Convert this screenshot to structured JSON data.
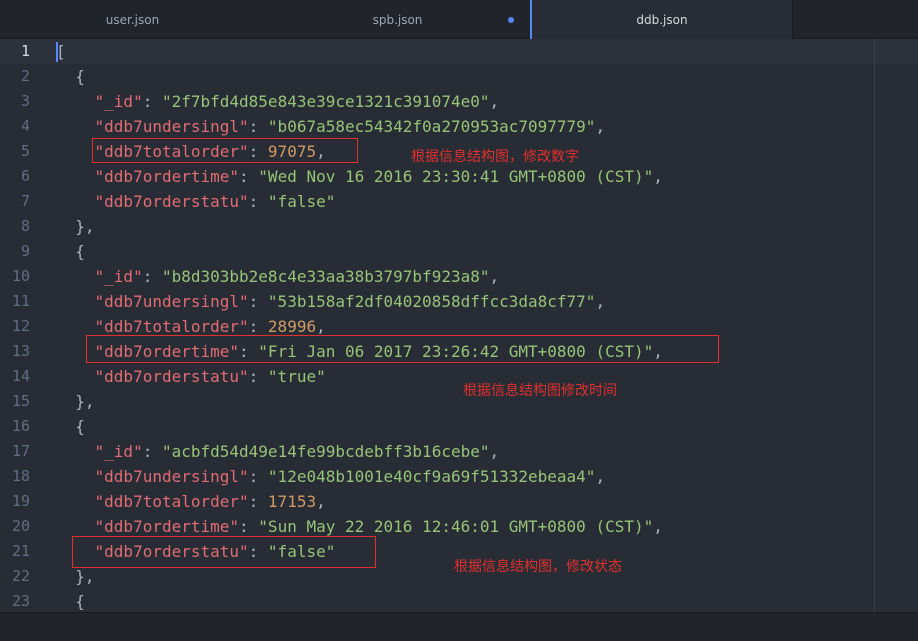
{
  "tabs": [
    {
      "label": "user.json",
      "modified": false,
      "active": false
    },
    {
      "label": "spb.json",
      "modified": true,
      "active": false
    },
    {
      "label": "ddb.json",
      "modified": false,
      "active": true
    }
  ],
  "line_numbers": [
    "1",
    "2",
    "3",
    "4",
    "5",
    "6",
    "7",
    "8",
    "9",
    "10",
    "11",
    "12",
    "13",
    "14",
    "15",
    "16",
    "17",
    "18",
    "19",
    "20",
    "21",
    "22",
    "23"
  ],
  "lines": [
    [
      {
        "t": "p",
        "v": "["
      }
    ],
    [
      {
        "t": "p",
        "v": "  {"
      }
    ],
    [
      {
        "t": "p",
        "v": "    "
      },
      {
        "t": "k",
        "v": "\"_id\""
      },
      {
        "t": "p",
        "v": ": "
      },
      {
        "t": "s",
        "v": "\"2f7bfd4d85e843e39ce1321c391074e0\""
      },
      {
        "t": "p",
        "v": ","
      }
    ],
    [
      {
        "t": "p",
        "v": "    "
      },
      {
        "t": "k",
        "v": "\"ddb7undersingl\""
      },
      {
        "t": "p",
        "v": ": "
      },
      {
        "t": "s",
        "v": "\"b067a58ec54342f0a270953ac7097779\""
      },
      {
        "t": "p",
        "v": ","
      }
    ],
    [
      {
        "t": "p",
        "v": "    "
      },
      {
        "t": "k",
        "v": "\"ddb7totalorder\""
      },
      {
        "t": "p",
        "v": ": "
      },
      {
        "t": "n",
        "v": "97075"
      },
      {
        "t": "p",
        "v": ","
      }
    ],
    [
      {
        "t": "p",
        "v": "    "
      },
      {
        "t": "k",
        "v": "\"ddb7ordertime\""
      },
      {
        "t": "p",
        "v": ": "
      },
      {
        "t": "s",
        "v": "\"Wed Nov 16 2016 23:30:41 GMT+0800 (CST)\""
      },
      {
        "t": "p",
        "v": ","
      }
    ],
    [
      {
        "t": "p",
        "v": "    "
      },
      {
        "t": "k",
        "v": "\"ddb7orderstatu\""
      },
      {
        "t": "p",
        "v": ": "
      },
      {
        "t": "s",
        "v": "\"false\""
      }
    ],
    [
      {
        "t": "p",
        "v": "  },"
      }
    ],
    [
      {
        "t": "p",
        "v": "  {"
      }
    ],
    [
      {
        "t": "p",
        "v": "    "
      },
      {
        "t": "k",
        "v": "\"_id\""
      },
      {
        "t": "p",
        "v": ": "
      },
      {
        "t": "s",
        "v": "\"b8d303bb2e8c4e33aa38b3797bf923a8\""
      },
      {
        "t": "p",
        "v": ","
      }
    ],
    [
      {
        "t": "p",
        "v": "    "
      },
      {
        "t": "k",
        "v": "\"ddb7undersingl\""
      },
      {
        "t": "p",
        "v": ": "
      },
      {
        "t": "s",
        "v": "\"53b158af2df04020858dffcc3da8cf77\""
      },
      {
        "t": "p",
        "v": ","
      }
    ],
    [
      {
        "t": "p",
        "v": "    "
      },
      {
        "t": "k",
        "v": "\"ddb7totalorder\""
      },
      {
        "t": "p",
        "v": ": "
      },
      {
        "t": "n",
        "v": "28996"
      },
      {
        "t": "p",
        "v": ","
      }
    ],
    [
      {
        "t": "p",
        "v": "    "
      },
      {
        "t": "k",
        "v": "\"ddb7ordertime\""
      },
      {
        "t": "p",
        "v": ": "
      },
      {
        "t": "s",
        "v": "\"Fri Jan 06 2017 23:26:42 GMT+0800 (CST)\""
      },
      {
        "t": "p",
        "v": ","
      }
    ],
    [
      {
        "t": "p",
        "v": "    "
      },
      {
        "t": "k",
        "v": "\"ddb7orderstatu\""
      },
      {
        "t": "p",
        "v": ": "
      },
      {
        "t": "s",
        "v": "\"true\""
      }
    ],
    [
      {
        "t": "p",
        "v": "  },"
      }
    ],
    [
      {
        "t": "p",
        "v": "  {"
      }
    ],
    [
      {
        "t": "p",
        "v": "    "
      },
      {
        "t": "k",
        "v": "\"_id\""
      },
      {
        "t": "p",
        "v": ": "
      },
      {
        "t": "s",
        "v": "\"acbfd54d49e14fe99bcdebff3b16cebe\""
      },
      {
        "t": "p",
        "v": ","
      }
    ],
    [
      {
        "t": "p",
        "v": "    "
      },
      {
        "t": "k",
        "v": "\"ddb7undersingl\""
      },
      {
        "t": "p",
        "v": ": "
      },
      {
        "t": "s",
        "v": "\"12e048b1001e40cf9a69f51332ebeaa4\""
      },
      {
        "t": "p",
        "v": ","
      }
    ],
    [
      {
        "t": "p",
        "v": "    "
      },
      {
        "t": "k",
        "v": "\"ddb7totalorder\""
      },
      {
        "t": "p",
        "v": ": "
      },
      {
        "t": "n",
        "v": "17153"
      },
      {
        "t": "p",
        "v": ","
      }
    ],
    [
      {
        "t": "p",
        "v": "    "
      },
      {
        "t": "k",
        "v": "\"ddb7ordertime\""
      },
      {
        "t": "p",
        "v": ": "
      },
      {
        "t": "s",
        "v": "\"Sun May 22 2016 12:46:01 GMT+0800 (CST)\""
      },
      {
        "t": "p",
        "v": ","
      }
    ],
    [
      {
        "t": "p",
        "v": "    "
      },
      {
        "t": "k",
        "v": "\"ddb7orderstatu\""
      },
      {
        "t": "p",
        "v": ": "
      },
      {
        "t": "s",
        "v": "\"false\""
      }
    ],
    [
      {
        "t": "p",
        "v": "  },"
      }
    ],
    [
      {
        "t": "p",
        "v": "  {"
      }
    ]
  ],
  "annotations": {
    "note_totalorder": "根据信息结构图，修改数字",
    "note_ordertime": "根据信息结构图修改时间",
    "note_orderstatu": "根据信息结构图，修改状态"
  },
  "colors": {
    "key": "#e06c75",
    "string": "#98c379",
    "number": "#d19a66",
    "annotation": "#e0302f",
    "accent": "#568af2"
  }
}
